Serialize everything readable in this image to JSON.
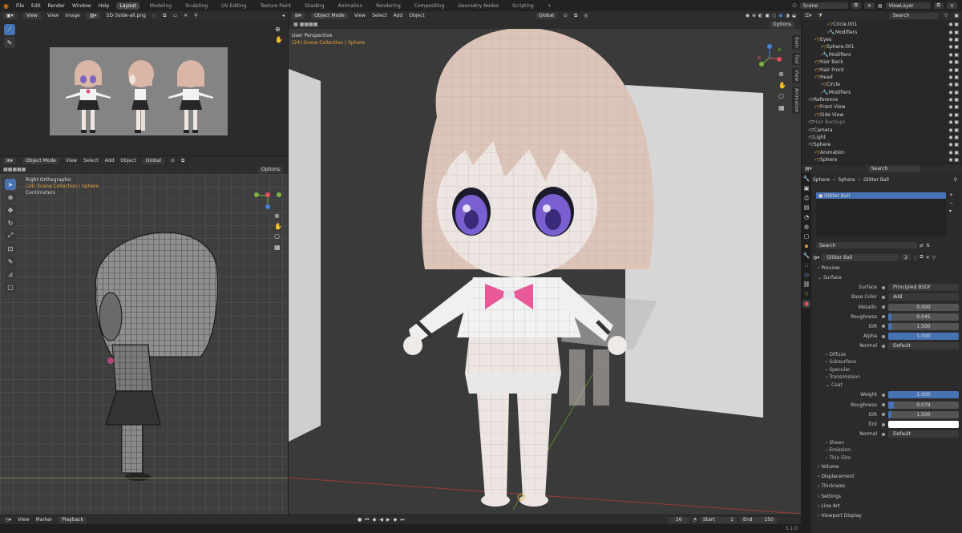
{
  "topbar": {
    "menus": [
      "File",
      "Edit",
      "Render",
      "Window",
      "Help"
    ],
    "workspaces": [
      "Layout",
      "Modeling",
      "Sculpting",
      "UV Editing",
      "Texture Paint",
      "Shading",
      "Animation",
      "Rendering",
      "Compositing",
      "Geometry Nodes",
      "Scripting"
    ],
    "active_workspace": "Layout",
    "add": "+",
    "scene": "Scene",
    "view_layer": "ViewLayer"
  },
  "image_editor": {
    "menus": [
      "View",
      "View",
      "Image"
    ],
    "image_name": "SD-3side-all.png",
    "reference_sheet": "front / side / back reference sheet"
  },
  "ortho_view": {
    "mode": "Object Mode",
    "menus": [
      "View",
      "Select",
      "Add",
      "Object"
    ],
    "orientation": "Global",
    "options": "Options",
    "title": "Right Orthographic",
    "collection": "(24) Scene Collection | Sphere",
    "units": "Centimeters"
  },
  "main_view": {
    "mode": "Object Mode",
    "menus": [
      "View",
      "Select",
      "Add",
      "Object"
    ],
    "orientation": "Global",
    "options": "Options",
    "title": "User Perspective",
    "collection": "(24) Scene Collection | Sphere",
    "side_tabs": [
      "Item",
      "Tool",
      "View",
      "Animation"
    ]
  },
  "timeline": {
    "menus": [
      "View",
      "Marker",
      "Playback"
    ],
    "frame": "26",
    "start_label": "Start",
    "start": "1",
    "end_label": "End",
    "end": "250",
    "version": "5.1.0"
  },
  "outliner": {
    "search_placeholder": "Search",
    "rows": [
      {
        "label": "Circle.001",
        "indent": 3
      },
      {
        "label": "Modifiers",
        "indent": 3
      },
      {
        "label": "Eyes",
        "indent": 1
      },
      {
        "label": "Sphere.001",
        "indent": 2
      },
      {
        "label": "Modifiers",
        "indent": 2
      },
      {
        "label": "Hair Back",
        "indent": 1
      },
      {
        "label": "Hair Front",
        "indent": 1
      },
      {
        "label": "Head",
        "indent": 1
      },
      {
        "label": "Circle",
        "indent": 2
      },
      {
        "label": "Modifiers",
        "indent": 2
      },
      {
        "label": "Reference",
        "indent": 0
      },
      {
        "label": "Front View",
        "indent": 1
      },
      {
        "label": "Side View",
        "indent": 1
      },
      {
        "label": "Hair Backups",
        "indent": 0
      },
      {
        "label": "Camera",
        "indent": 0
      },
      {
        "label": "Light",
        "indent": 0
      },
      {
        "label": "Sphere",
        "indent": 0
      },
      {
        "label": "Animation",
        "indent": 1
      },
      {
        "label": "Sphere",
        "indent": 1
      },
      {
        "label": "Modifiers",
        "indent": 1
      }
    ]
  },
  "properties": {
    "search_placeholder": "Search",
    "breadcrumb": [
      "Sphere",
      "Sphere",
      "Glitter Ball"
    ],
    "material_slot": "Glitter Ball",
    "slot_search_placeholder": "Search",
    "material_name": "Glitter Ball",
    "users": "2",
    "sections": {
      "preview": "Preview",
      "surface": "Surface",
      "diffuse": "Diffuse",
      "subsurface": "Subsurface",
      "specular": "Specular",
      "transmission": "Transmission",
      "coat": "Coat",
      "sheen": "Sheen",
      "emission": "Emission",
      "thin_film": "Thin Film",
      "volume": "Volume",
      "displacement": "Displacement",
      "thickness": "Thickness",
      "settings": "Settings",
      "line_art": "Line Art",
      "viewport_display": "Viewport Display"
    },
    "surface_fields": [
      {
        "label": "Surface",
        "value": "Principled BSDF",
        "fill": 0
      },
      {
        "label": "Base Color",
        "value": "Add",
        "fill": 0
      },
      {
        "label": "Metallic",
        "value": "0.000",
        "fill": 0
      },
      {
        "label": "Roughness",
        "value": "0.045",
        "fill": 0.045
      },
      {
        "label": "IOR",
        "value": "1.500",
        "fill": 0.04
      },
      {
        "label": "Alpha",
        "value": "1.000",
        "fill": 1
      },
      {
        "label": "Normal",
        "value": "Default",
        "fill": 0
      }
    ],
    "coat_fields": [
      {
        "label": "Weight",
        "value": "1.000",
        "fill": 1
      },
      {
        "label": "Roughness",
        "value": "0.079",
        "fill": 0.079
      },
      {
        "label": "IOR",
        "value": "1.500",
        "fill": 0.04
      },
      {
        "label": "Tint",
        "value": "",
        "fill": 0
      },
      {
        "label": "Normal",
        "value": "Default",
        "fill": 0
      }
    ]
  },
  "colors": {
    "accent": "#4772b3",
    "header": "#2d2d2d",
    "viewport": "#3d3d3d"
  }
}
